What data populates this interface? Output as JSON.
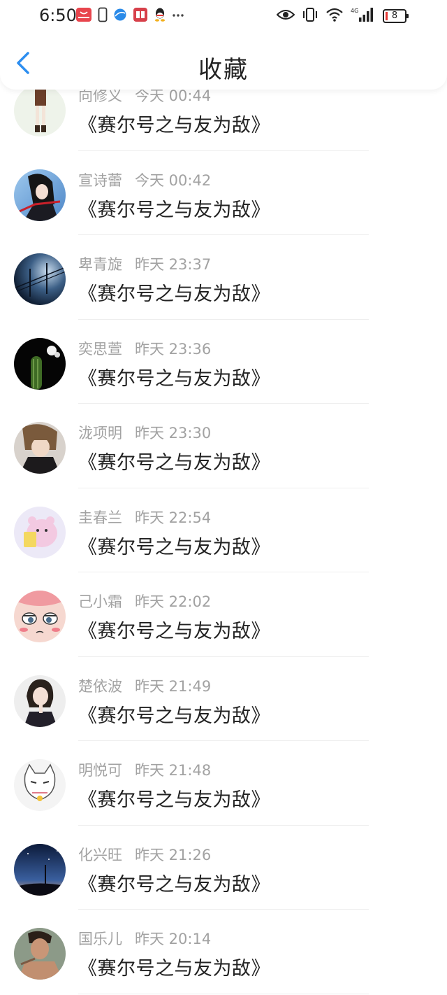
{
  "status_bar": {
    "time": "6:50",
    "network": "4G",
    "battery": "8"
  },
  "header": {
    "title": "收藏"
  },
  "favorites": [
    {
      "user": "向修义",
      "time": "今天 00:44",
      "title": "《赛尔号之与友为敌》"
    },
    {
      "user": "宣诗蕾",
      "time": "今天 00:42",
      "title": "《赛尔号之与友为敌》"
    },
    {
      "user": "卑青旋",
      "time": "昨天 23:37",
      "title": "《赛尔号之与友为敌》"
    },
    {
      "user": "奕思萱",
      "time": "昨天 23:36",
      "title": "《赛尔号之与友为敌》"
    },
    {
      "user": "泷项明",
      "time": "昨天 23:30",
      "title": "《赛尔号之与友为敌》"
    },
    {
      "user": "圭春兰",
      "time": "昨天 22:54",
      "title": "《赛尔号之与友为敌》"
    },
    {
      "user": "己小霜",
      "time": "昨天 22:02",
      "title": "《赛尔号之与友为敌》"
    },
    {
      "user": "楚依波",
      "time": "昨天 21:49",
      "title": "《赛尔号之与友为敌》"
    },
    {
      "user": "明悦可",
      "time": "昨天 21:48",
      "title": "《赛尔号之与友为敌》"
    },
    {
      "user": "化兴旺",
      "time": "昨天 21:26",
      "title": "《赛尔号之与友为敌》"
    },
    {
      "user": "国乐儿",
      "time": "昨天 20:14",
      "title": "《赛尔号之与友为敌》"
    }
  ],
  "colors": {
    "accent": "#2d8ef0",
    "text_primary": "#222222",
    "text_secondary": "#a2a2a2"
  }
}
